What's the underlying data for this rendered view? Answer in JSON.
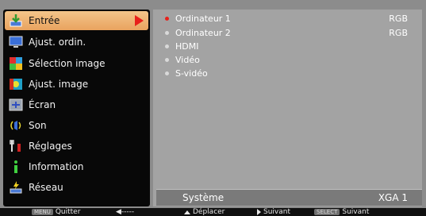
{
  "menu": {
    "items": [
      {
        "label": "Entrée",
        "icon": "input-icon"
      },
      {
        "label": "Ajust. ordin.",
        "icon": "computer-adjust-icon"
      },
      {
        "label": "Sélection image",
        "icon": "image-select-icon"
      },
      {
        "label": "Ajust. image",
        "icon": "image-adjust-icon"
      },
      {
        "label": "Écran",
        "icon": "screen-icon"
      },
      {
        "label": "Son",
        "icon": "sound-icon"
      },
      {
        "label": "Réglages",
        "icon": "settings-icon"
      },
      {
        "label": "Information",
        "icon": "information-icon"
      },
      {
        "label": "Réseau",
        "icon": "network-icon"
      }
    ],
    "selected_index": 0
  },
  "inputs": {
    "items": [
      {
        "label": "Ordinateur 1",
        "value": "RGB"
      },
      {
        "label": "Ordinateur 2",
        "value": "RGB"
      },
      {
        "label": "HDMI",
        "value": ""
      },
      {
        "label": "Vidéo",
        "value": ""
      },
      {
        "label": "S-vidéo",
        "value": ""
      }
    ],
    "active_index": 0
  },
  "system": {
    "label": "Système",
    "value": "XGA 1"
  },
  "footer": {
    "quit_key": "MENU",
    "quit_label": "Quitter",
    "back_label": "◀-----",
    "move_label": "Déplacer",
    "next_label": "Suivant",
    "select_key": "SELECT",
    "select_next_label": "Suivant"
  },
  "colors": {
    "accent": "#e8201a",
    "selected_bg": "#eeb273",
    "panel": "#a3a3a3"
  }
}
